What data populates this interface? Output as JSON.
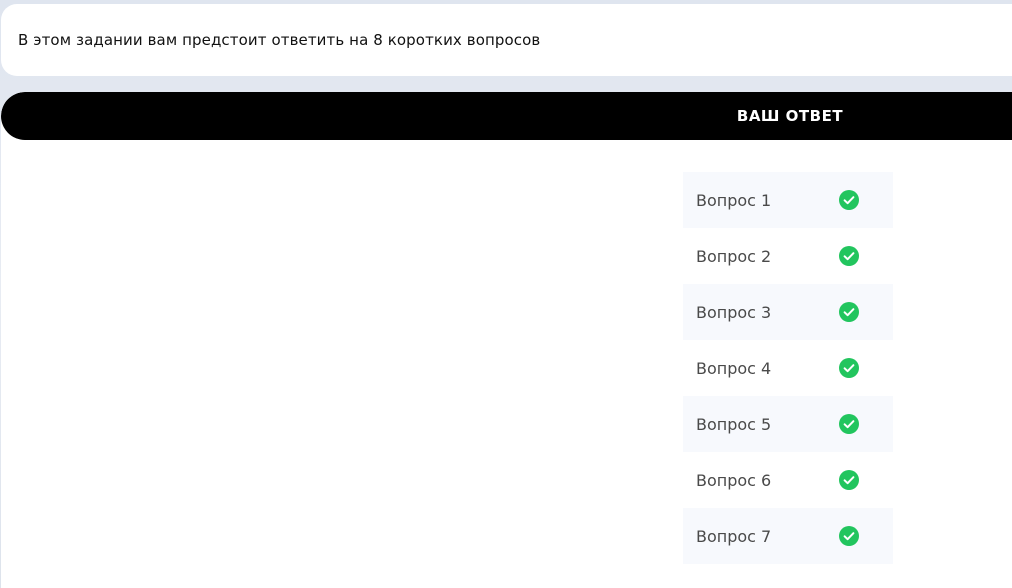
{
  "intro": {
    "text": "В этом задании вам предстоит ответить на 8 коротких вопросов"
  },
  "answer_panel": {
    "title": "ВАШ ОТВЕТ",
    "questions": [
      {
        "label": "Вопрос 1",
        "status": "answered"
      },
      {
        "label": "Вопрос 2",
        "status": "answered"
      },
      {
        "label": "Вопрос 3",
        "status": "answered"
      },
      {
        "label": "Вопрос 4",
        "status": "answered"
      },
      {
        "label": "Вопрос 5",
        "status": "answered"
      },
      {
        "label": "Вопрос 6",
        "status": "answered"
      },
      {
        "label": "Вопрос 7",
        "status": "answered"
      }
    ]
  },
  "colors": {
    "header_bg": "#000000",
    "check_green": "#22c55e",
    "row_alt_bg": "#f7f9fd"
  },
  "icons": {
    "status_answered": "check-circle-icon"
  }
}
